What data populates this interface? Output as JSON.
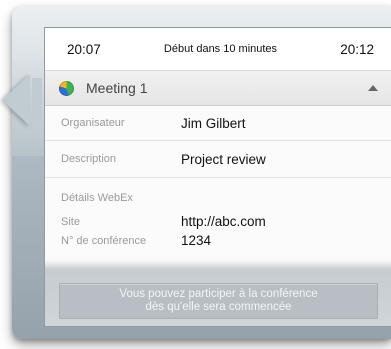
{
  "header": {
    "start_time": "20:07",
    "status": "Début dans 10 minutes",
    "end_time": "20:12"
  },
  "meeting": {
    "title": "Meeting 1",
    "icon": "webex-globe-icon",
    "expanded": true
  },
  "details": {
    "organizer_label": "Organisateur",
    "organizer_value": "Jim Gilbert",
    "description_label": "Description",
    "description_value": "Project review"
  },
  "webex": {
    "title": "Détails WebEx",
    "site_label": "Site",
    "site_value": "http://abc.com",
    "conference_label": "N° de conférence",
    "conference_value": "1234"
  },
  "join_button": {
    "line1": "Vous pouvez participer à la conférence",
    "line2": "dès qu'elle sera commencée",
    "enabled": false
  },
  "colors": {
    "frame": "#b7c3cb",
    "panel": "#fafafa",
    "disabled_button": "#b8bec3"
  }
}
